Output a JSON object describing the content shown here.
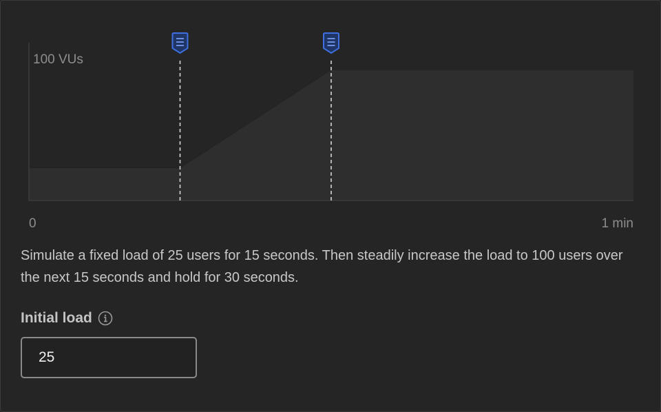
{
  "chart_data": {
    "type": "area",
    "x_unit": "seconds",
    "points": [
      {
        "x": 0,
        "y": 25
      },
      {
        "x": 15,
        "y": 25
      },
      {
        "x": 30,
        "y": 100
      },
      {
        "x": 60,
        "y": 100
      }
    ],
    "xlim": [
      0,
      60
    ],
    "ylim": [
      0,
      100
    ],
    "y_tick_label": "100 VUs",
    "x_tick_start": "0",
    "x_tick_end": "1 min",
    "markers": [
      {
        "x": 15,
        "icon": "stage-marker-icon"
      },
      {
        "x": 30,
        "icon": "stage-marker-icon"
      }
    ],
    "colors": {
      "area_fill": "#2e2e2e",
      "marker": "#3f6fe0",
      "marker_line": "#d8d8d8"
    }
  },
  "description": "Simulate a fixed load of 25 users for 15 seconds. Then steadily increase the load to 100 users over the next 15 seconds and hold for 30 seconds.",
  "initial_load": {
    "label": "Initial load",
    "info_icon": "info-icon",
    "value": "25"
  }
}
